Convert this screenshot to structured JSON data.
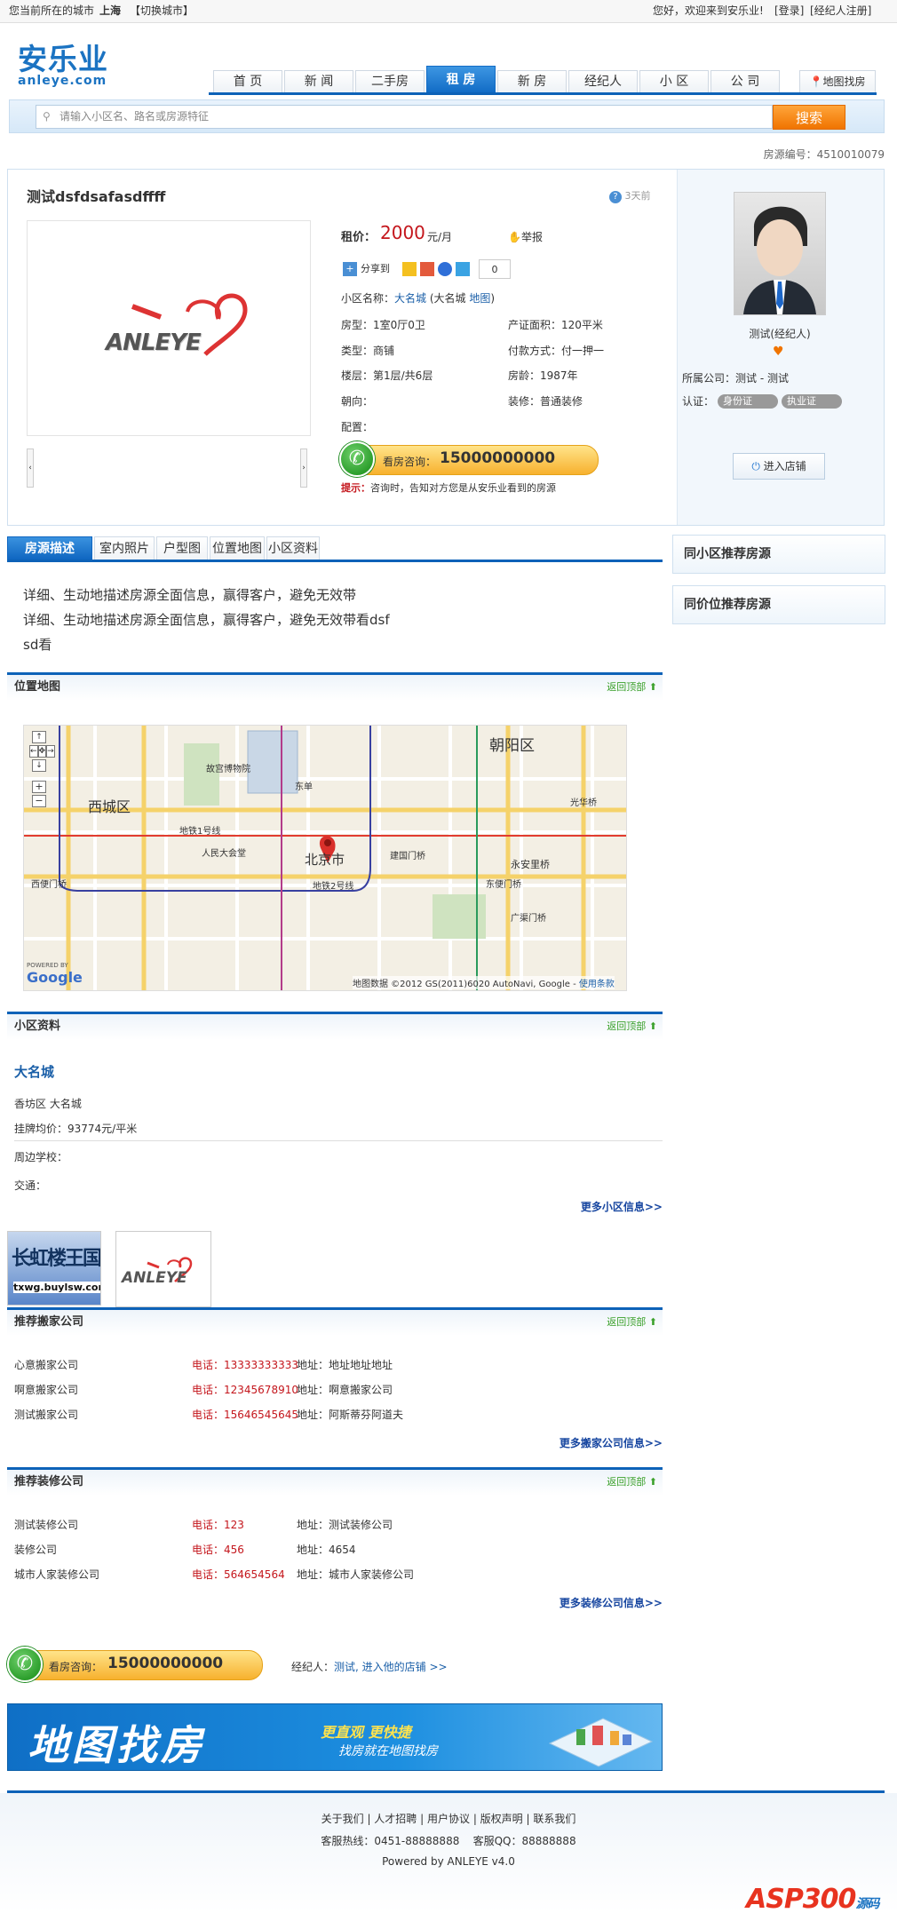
{
  "topbar": {
    "city_prefix": "您当前所在的城市",
    "city": "上海",
    "switch_city": "【切换城市】",
    "welcome": "您好，欢迎来到安乐业!",
    "login": "[登录]",
    "register": "[经纪人注册]"
  },
  "logo": {
    "cn": "安乐业",
    "en": "anleye.com"
  },
  "nav": {
    "items": [
      "首 页",
      "新 闻",
      "二手房",
      "租 房",
      "新 房",
      "经纪人",
      "小 区",
      "公 司"
    ],
    "active_index": 3,
    "map_search": "地图找房"
  },
  "search": {
    "placeholder": "请输入小区名、路名或房源特征",
    "button": "搜索"
  },
  "listing_no": "房源编号：4510010079",
  "detail": {
    "title": "测试dsfdsafasdffff",
    "time_ago": "3天前",
    "photo_logo": "ANLEYE",
    "rent_label": "租价：",
    "rent_value": "2000",
    "rent_unit": "元/月",
    "report": "举报",
    "share": "分享到",
    "share_count": "0",
    "community_label": "小区名称：",
    "community_name": "大名城",
    "community_alias": "(大名城",
    "map_link": "地图",
    "community_close": ")",
    "fields": {
      "layout": "房型：1室0厅0卫",
      "area": "产证面积：120平米",
      "type": "类型：商铺",
      "payment": "付款方式：付一押一",
      "floor": "楼层：第1层/共6层",
      "age": "房龄：1987年",
      "orientation": "朝向：",
      "decoration": "装修：普通装修",
      "config": "配置："
    },
    "consult_label": "看房咨询：",
    "consult_phone": "15000000000",
    "tip_label": "提示：",
    "tip_text": "咨询时，告知对方您是从安乐业看到的房源"
  },
  "agent": {
    "name": "测试(经纪人)",
    "company_label": "所属公司：",
    "company": "测试 - 测试",
    "cert_label": "认证：",
    "cert_id": "身份证",
    "cert_license": "执业证",
    "shop_button": "进入店铺"
  },
  "tabs": [
    "房源描述",
    "室内照片",
    "户型图",
    "位置地图",
    "小区资料"
  ],
  "description": [
    "详细、生动地描述房源全面信息，赢得客户，避免无效带",
    "详细、生动地描述房源全面信息，赢得客户，避免无效带看dsf",
    "sd看"
  ],
  "side": {
    "same_community": "同小区推荐房源",
    "same_price": "同价位推荐房源"
  },
  "back_to_top": "返回顶部",
  "location": {
    "title": "位置地图",
    "map_labels": {
      "chaoyang": "朝阳区",
      "xicheng": "西城区",
      "beijing": "北京市",
      "line1": "地铁1号线",
      "line2": "地铁2号线",
      "dongdan": "东单",
      "guangfeng": "广渠门桥",
      "yongan": "永安里桥",
      "dongbian": "东便门桥",
      "xibian": "西便门桥",
      "tianan": "人民大会堂",
      "gugong": "故宫博物院",
      "jianguo": "建国门桥",
      "guomao": "光华桥",
      "google": "Google",
      "powered": "POWERED BY",
      "copyright": "地图数据 ©2012 GS(2011)6020 AutoNavi, Google -",
      "terms": "使用条款"
    }
  },
  "community": {
    "title": "小区资料",
    "name": "大名城",
    "district": "香坊区 大名城",
    "avg_price": "挂牌均价：93774元/平米",
    "schools": "周边学校：",
    "traffic": "交通：",
    "more": "更多小区信息>>"
  },
  "thumbs": {
    "first_title": "长虹楼王国",
    "first_url": "txwg.buylsw.com",
    "second_logo": "ANLEYE"
  },
  "movers": {
    "title": "推荐搬家公司",
    "rows": [
      {
        "name": "心意搬家公司",
        "phone": "电话：13333333333",
        "address": "地址：地址地址地址"
      },
      {
        "name": "啊意搬家公司",
        "phone": "电话：12345678910",
        "address": "地址：啊意搬家公司"
      },
      {
        "name": "测试搬家公司",
        "phone": "电话：15646545645",
        "address": "地址：阿斯蒂芬阿道夫"
      }
    ],
    "more": "更多搬家公司信息>>"
  },
  "decor": {
    "title": "推荐装修公司",
    "rows": [
      {
        "name": "测试装修公司",
        "phone": "电话：123",
        "address": "地址：测试装修公司"
      },
      {
        "name": "装修公司",
        "phone": "电话：456",
        "address": "地址：4654"
      },
      {
        "name": "城市人家装修公司",
        "phone": "电话：564654564",
        "address": "地址：城市人家装修公司"
      }
    ],
    "more": "更多装修公司信息>>"
  },
  "bottom_contact": {
    "consult_label": "看房咨询：",
    "phone": "15000000000",
    "agent_label": "经纪人：",
    "agent_link": "测试, 进入他的店铺 >>"
  },
  "banner": {
    "title": "地图找房",
    "slogan1": "更直观 更快捷",
    "slogan2": "找房就在地图找房"
  },
  "footer": {
    "links": [
      "关于我们",
      "人才招聘",
      "用户协议",
      "版权声明",
      "联系我们"
    ],
    "hotline": "客服热线：0451-88888888",
    "qq": "客服QQ：88888888",
    "powered": "Powered by ANLEYE v4.0",
    "watermark_main": "ASP300",
    "watermark_sub": "源码"
  },
  "colors": {
    "brand_blue": "#0d62b8",
    "price_red": "#c4161c",
    "search_orange": "#f07400"
  }
}
